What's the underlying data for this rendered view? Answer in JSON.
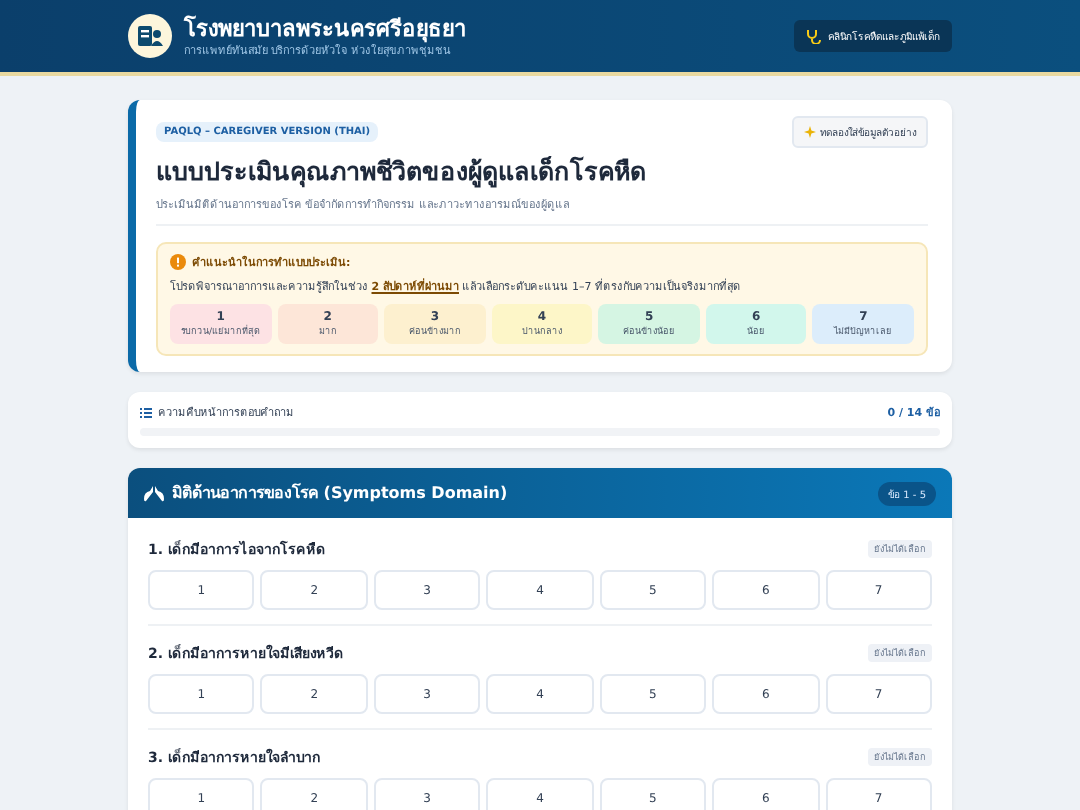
{
  "header": {
    "title": "โรงพยาบาลพระนครศรีอยุธยา",
    "subtitle": "การแพทย์ทันสมัย บริการด้วยหัวใจ ห่วงใยสุขภาพชุมชน",
    "clinic_button": "คลินิกโรคหืดและภูมิแพ้เด็ก"
  },
  "form": {
    "tag": "PAQLQ – CAREGIVER VERSION (THAI)",
    "sample_button": "ทดลองใส่ข้อมูลตัวอย่าง",
    "title": "แบบประเมินคุณภาพชีวิตของผู้ดูแลเด็กโรคหืด",
    "subtitle": "ประเมินมิติด้านอาการของโรค ข้อจำกัดการทำกิจกรรม และภาวะทางอารมณ์ของผู้ดูแล",
    "instructions": {
      "heading": "คำแนะนำในการทำแบบประเมิน:",
      "text": "โปรดพิจารณาอาการและความรู้สึกในช่วง **2 สัปดาห์ที่ผ่านมา** แล้วเลือกระดับคะแนน 1–7 ที่ตรงกับความเป็นจริงมากที่สุด",
      "scale": [
        {
          "value": "1",
          "label": "รบกวน/แย่มากที่สุด",
          "color": "#fde2e4"
        },
        {
          "value": "2",
          "label": "มาก",
          "color": "#fde6d8"
        },
        {
          "value": "3",
          "label": "ค่อนข้างมาก",
          "color": "#fdf0cf"
        },
        {
          "value": "4",
          "label": "ปานกลาง",
          "color": "#fdf6c8"
        },
        {
          "value": "5",
          "label": "ค่อนข้างน้อย",
          "color": "#d5f5e3"
        },
        {
          "value": "6",
          "label": "น้อย",
          "color": "#d2f7ec"
        },
        {
          "value": "7",
          "label": "ไม่มีปัญหาเลย",
          "color": "#dcedfb"
        }
      ]
    }
  },
  "progress": {
    "label": "ความคืบหน้าการตอบคำถาม",
    "count": "0 / 14 ข้อ",
    "level": 0
  },
  "section": {
    "title": "มิติด้านอาการของโรค (Symptoms Domain)",
    "badge": "ข้อ 1 - 5",
    "questions": [
      {
        "text": "1. เด็กมีอาการไอจากโรคหืด",
        "status": "ยังไม่ได้เลือก",
        "options": [
          {
            "label": "1",
            "selected": false
          },
          {
            "label": "2",
            "selected": false
          },
          {
            "label": "3",
            "selected": false
          },
          {
            "label": "4",
            "selected": false
          },
          {
            "label": "5",
            "selected": false
          },
          {
            "label": "6",
            "selected": false
          },
          {
            "label": "7",
            "selected": false
          }
        ]
      },
      {
        "text": "2. เด็กมีอาการหายใจมีเสียงหวีด",
        "status": "ยังไม่ได้เลือก",
        "options": [
          {
            "label": "1",
            "selected": false
          },
          {
            "label": "2",
            "selected": false
          },
          {
            "label": "3",
            "selected": false
          },
          {
            "label": "4",
            "selected": false
          },
          {
            "label": "5",
            "selected": false
          },
          {
            "label": "6",
            "selected": false
          },
          {
            "label": "7",
            "selected": false
          }
        ]
      },
      {
        "text": "3. เด็กมีอาการหายใจลำบาก",
        "status": "ยังไม่ได้เลือก",
        "options": [
          {
            "label": "1",
            "selected": false
          },
          {
            "label": "2",
            "selected": false
          },
          {
            "label": "3",
            "selected": false
          },
          {
            "label": "4",
            "selected": false
          },
          {
            "label": "5",
            "selected": false
          },
          {
            "label": "6",
            "selected": false
          },
          {
            "label": "7",
            "selected": false
          }
        ]
      }
    ]
  }
}
